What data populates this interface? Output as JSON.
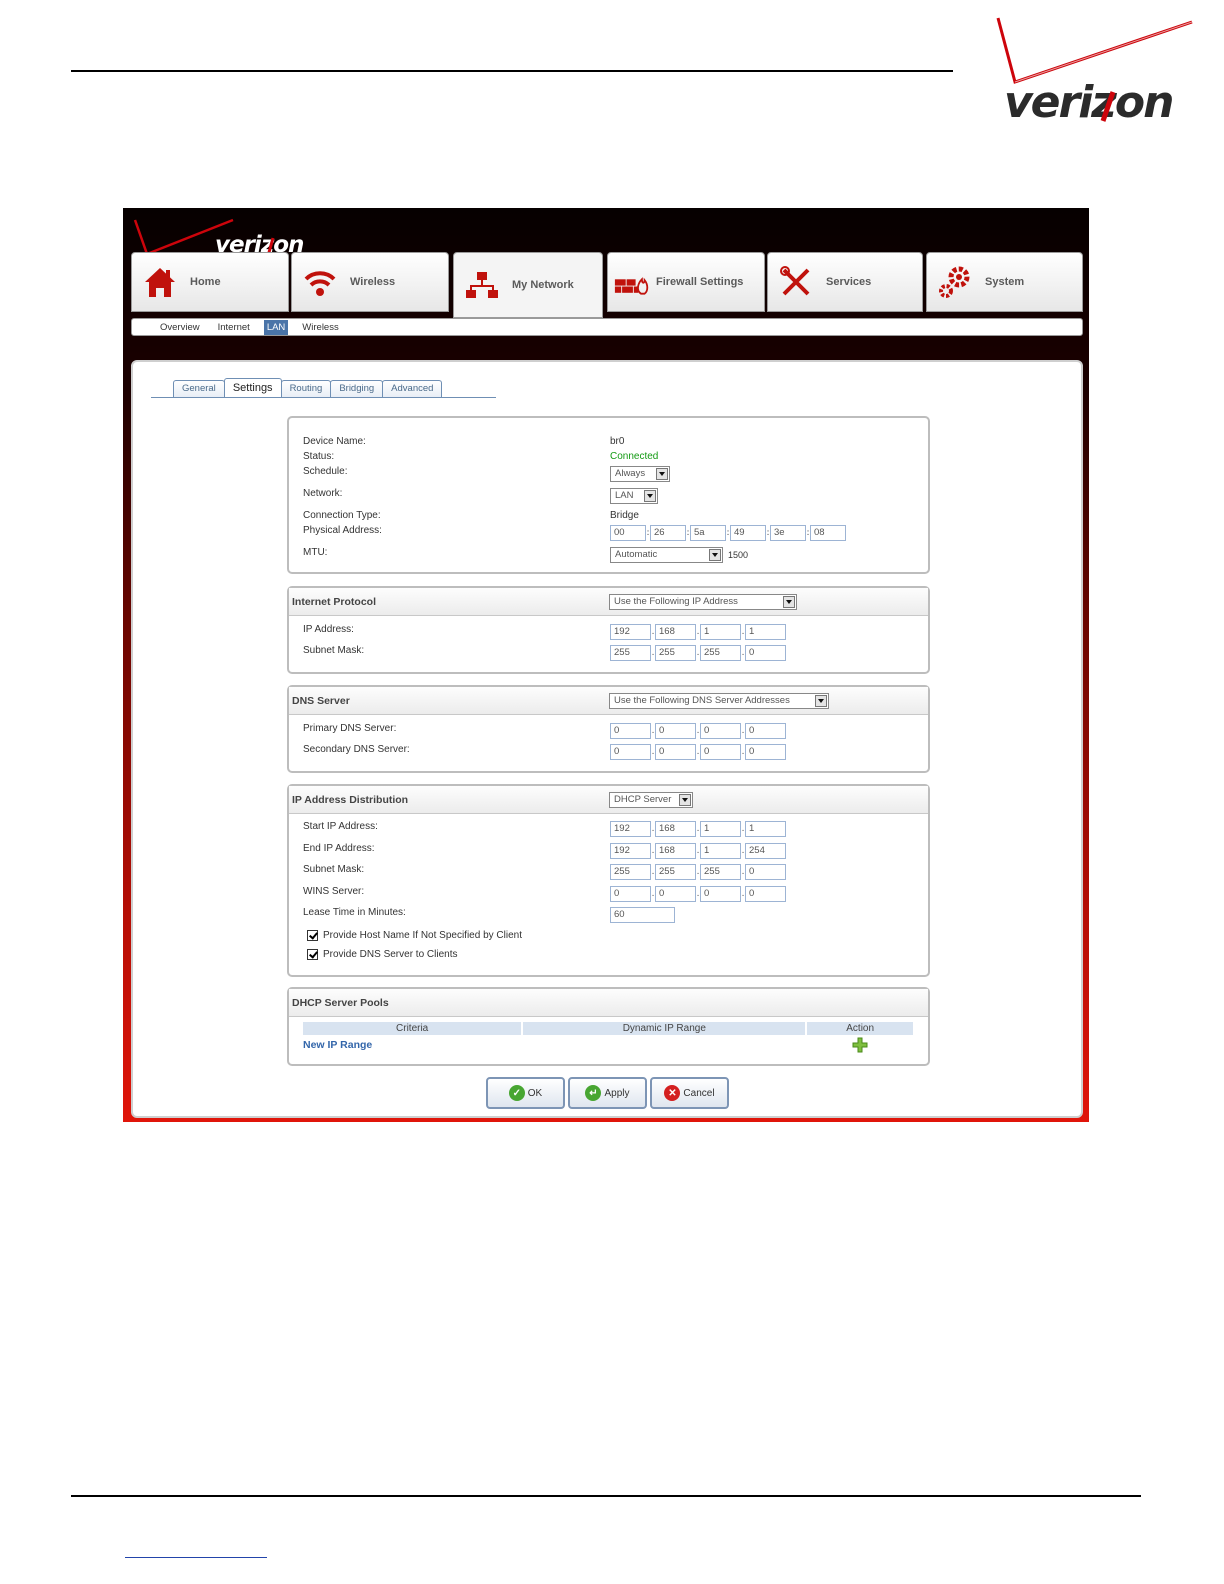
{
  "brand": {
    "name": "verizon",
    "colors": {
      "red": "#cd040b",
      "dark": "#2b2b2b",
      "link": "#3366aa",
      "status_green": "#139a13"
    }
  },
  "main_tabs": [
    {
      "label": "Home",
      "icon": "home-icon"
    },
    {
      "label": "Wireless",
      "icon": "wireless-icon"
    },
    {
      "label": "My Network",
      "icon": "network-icon",
      "active": true
    },
    {
      "label": "Firewall Settings",
      "icon": "firewall-icon"
    },
    {
      "label": "Services",
      "icon": "services-icon"
    },
    {
      "label": "System",
      "icon": "gear-icon"
    }
  ],
  "subnav": [
    {
      "label": "Overview"
    },
    {
      "label": "Internet"
    },
    {
      "label": "LAN",
      "active": true
    },
    {
      "label": "Wireless"
    }
  ],
  "settings_tabs": [
    {
      "label": "General"
    },
    {
      "label": "Settings",
      "active": true
    },
    {
      "label": "Routing"
    },
    {
      "label": "Bridging"
    },
    {
      "label": "Advanced"
    }
  ],
  "device": {
    "device_name_label": "Device Name:",
    "device_name": "br0",
    "status_label": "Status:",
    "status": "Connected",
    "schedule_label": "Schedule:",
    "schedule": "Always",
    "network_label": "Network:",
    "network": "LAN",
    "connection_type_label": "Connection Type:",
    "connection_type": "Bridge",
    "physical_address_label": "Physical Address:",
    "physical_address": [
      "00",
      "26",
      "5a",
      "49",
      "3e",
      "08"
    ],
    "mtu_label": "MTU:",
    "mtu_mode": "Automatic",
    "mtu_value": "1500"
  },
  "internet_protocol": {
    "title": "Internet Protocol",
    "mode": "Use the Following IP Address",
    "ip_label": "IP Address:",
    "ip": [
      "192",
      "168",
      "1",
      "1"
    ],
    "subnet_label": "Subnet Mask:",
    "subnet": [
      "255",
      "255",
      "255",
      "0"
    ]
  },
  "dns_server": {
    "title": "DNS Server",
    "mode": "Use the Following DNS Server Addresses",
    "primary_label": "Primary DNS Server:",
    "primary": [
      "0",
      "0",
      "0",
      "0"
    ],
    "secondary_label": "Secondary DNS Server:",
    "secondary": [
      "0",
      "0",
      "0",
      "0"
    ]
  },
  "ip_distribution": {
    "title": "IP Address Distribution",
    "mode": "DHCP Server",
    "start_label": "Start IP Address:",
    "start": [
      "192",
      "168",
      "1",
      "1"
    ],
    "end_label": "End IP Address:",
    "end": [
      "192",
      "168",
      "1",
      "254"
    ],
    "subnet_label": "Subnet Mask:",
    "subnet": [
      "255",
      "255",
      "255",
      "0"
    ],
    "wins_label": "WINS Server:",
    "wins": [
      "0",
      "0",
      "0",
      "0"
    ],
    "lease_label": "Lease Time in Minutes:",
    "lease": "60",
    "host_name_check": "Provide Host Name If Not Specified by Client",
    "dns_check": "Provide DNS Server to Clients"
  },
  "dhcp_pools": {
    "title": "DHCP Server Pools",
    "columns": [
      "Criteria",
      "Dynamic IP Range",
      "Action"
    ],
    "new_range": "New IP Range"
  },
  "buttons": {
    "ok": "OK",
    "apply": "Apply",
    "cancel": "Cancel"
  }
}
